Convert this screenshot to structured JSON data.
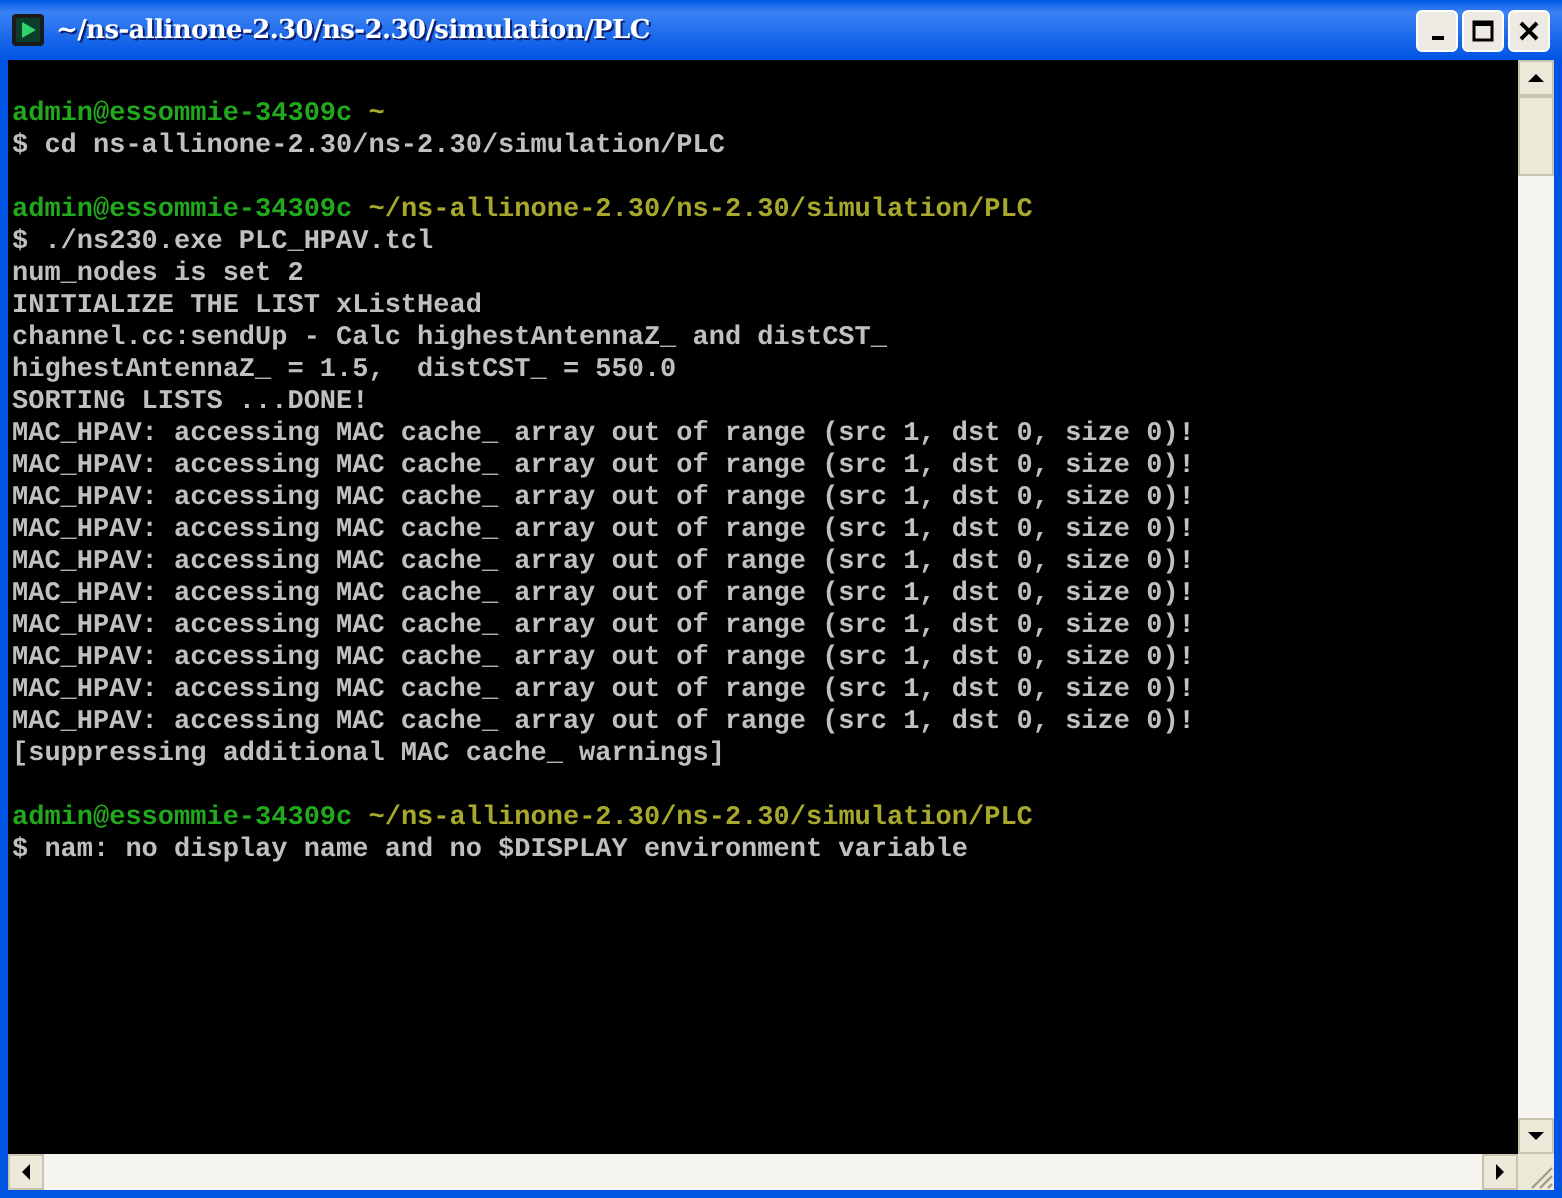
{
  "window": {
    "title": "~/ns-allinone-2.30/ns-2.30/simulation/PLC"
  },
  "terminal": {
    "lines": [
      {
        "kind": "blank"
      },
      {
        "kind": "prompt",
        "user": "admin@essommie-34309c",
        "path": "~"
      },
      {
        "kind": "output",
        "text": "$ cd ns-allinone-2.30/ns-2.30/simulation/PLC"
      },
      {
        "kind": "blank"
      },
      {
        "kind": "prompt",
        "user": "admin@essommie-34309c",
        "path": "~/ns-allinone-2.30/ns-2.30/simulation/PLC"
      },
      {
        "kind": "output",
        "text": "$ ./ns230.exe PLC_HPAV.tcl"
      },
      {
        "kind": "output",
        "text": "num_nodes is set 2"
      },
      {
        "kind": "output",
        "text": "INITIALIZE THE LIST xListHead"
      },
      {
        "kind": "output",
        "text": "channel.cc:sendUp - Calc highestAntennaZ_ and distCST_"
      },
      {
        "kind": "output",
        "text": "highestAntennaZ_ = 1.5,  distCST_ = 550.0"
      },
      {
        "kind": "output",
        "text": "SORTING LISTS ...DONE!"
      },
      {
        "kind": "output",
        "text": "MAC_HPAV: accessing MAC cache_ array out of range (src 1, dst 0, size 0)!"
      },
      {
        "kind": "output",
        "text": "MAC_HPAV: accessing MAC cache_ array out of range (src 1, dst 0, size 0)!"
      },
      {
        "kind": "output",
        "text": "MAC_HPAV: accessing MAC cache_ array out of range (src 1, dst 0, size 0)!"
      },
      {
        "kind": "output",
        "text": "MAC_HPAV: accessing MAC cache_ array out of range (src 1, dst 0, size 0)!"
      },
      {
        "kind": "output",
        "text": "MAC_HPAV: accessing MAC cache_ array out of range (src 1, dst 0, size 0)!"
      },
      {
        "kind": "output",
        "text": "MAC_HPAV: accessing MAC cache_ array out of range (src 1, dst 0, size 0)!"
      },
      {
        "kind": "output",
        "text": "MAC_HPAV: accessing MAC cache_ array out of range (src 1, dst 0, size 0)!"
      },
      {
        "kind": "output",
        "text": "MAC_HPAV: accessing MAC cache_ array out of range (src 1, dst 0, size 0)!"
      },
      {
        "kind": "output",
        "text": "MAC_HPAV: accessing MAC cache_ array out of range (src 1, dst 0, size 0)!"
      },
      {
        "kind": "output",
        "text": "MAC_HPAV: accessing MAC cache_ array out of range (src 1, dst 0, size 0)!"
      },
      {
        "kind": "output",
        "text": "[suppressing additional MAC cache_ warnings]"
      },
      {
        "kind": "blank"
      },
      {
        "kind": "prompt",
        "user": "admin@essommie-34309c",
        "path": "~/ns-allinone-2.30/ns-2.30/simulation/PLC"
      },
      {
        "kind": "output",
        "text": "$ nam: no display name and no $DISPLAY environment variable"
      }
    ]
  }
}
